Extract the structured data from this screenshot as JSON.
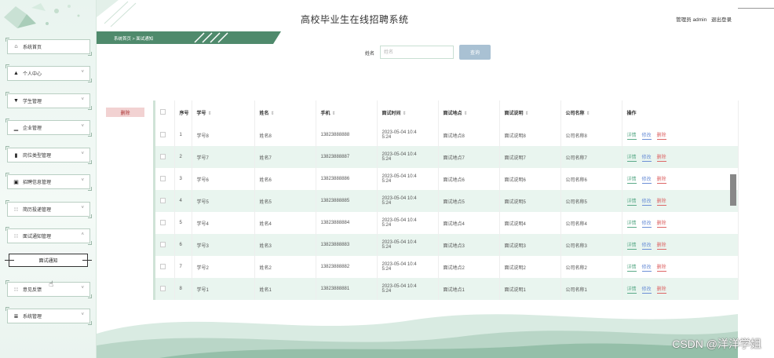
{
  "app": {
    "title": "高校毕业生在线招聘系统",
    "user_label": "管理员 admin",
    "logout_label": "退出登录"
  },
  "breadcrumb": {
    "text": "系统首页 > 面试通知"
  },
  "sidebar": {
    "items": [
      {
        "label": "系统首页",
        "icon": "home-icon",
        "glyph": "⌂"
      },
      {
        "label": "个人中心",
        "icon": "person-icon",
        "glyph": "▲"
      },
      {
        "label": "学生管理",
        "icon": "shield-icon",
        "glyph": "▼"
      },
      {
        "label": "企业管理",
        "icon": "bar-chart-icon",
        "glyph": "▁"
      },
      {
        "label": "岗位类型管理",
        "icon": "book-icon",
        "glyph": "▮"
      },
      {
        "label": "招聘信息管理",
        "icon": "grid-icon",
        "glyph": "▣"
      },
      {
        "label": "简历投递管理",
        "icon": "apps-icon",
        "glyph": "∷"
      },
      {
        "label": "面试通知管理",
        "icon": "apps-icon",
        "glyph": "∷"
      },
      {
        "label": "意见反馈",
        "icon": "apps-icon",
        "glyph": "∷"
      },
      {
        "label": "系统管理",
        "icon": "list-icon",
        "glyph": "≣"
      }
    ],
    "sub_item": "面试通知"
  },
  "search": {
    "label": "姓名",
    "placeholder": "姓名",
    "button": "查询"
  },
  "batch_delete": "删除",
  "table": {
    "headers": [
      "序号",
      "学号",
      "姓名",
      "手机",
      "面试时间",
      "面试地点",
      "面试说明",
      "公司名称",
      "操作"
    ],
    "actions": {
      "detail": "详情",
      "edit": "修改",
      "delete": "删除"
    },
    "rows": [
      {
        "no": "1",
        "sid": "学号8",
        "name": "姓名8",
        "phone": "13823888888",
        "time1": "2023-05-04 10:4",
        "time2": "5:24",
        "place": "面试地点8",
        "note": "面试说明8",
        "company": "公司名称8"
      },
      {
        "no": "2",
        "sid": "学号7",
        "name": "姓名7",
        "phone": "13823888887",
        "time1": "2023-05-04 10:4",
        "time2": "5:24",
        "place": "面试地点7",
        "note": "面试说明7",
        "company": "公司名称7"
      },
      {
        "no": "3",
        "sid": "学号6",
        "name": "姓名6",
        "phone": "13823888886",
        "time1": "2023-05-04 10:4",
        "time2": "5:24",
        "place": "面试地点6",
        "note": "面试说明6",
        "company": "公司名称6"
      },
      {
        "no": "4",
        "sid": "学号5",
        "name": "姓名5",
        "phone": "13823888885",
        "time1": "2023-05-04 10:4",
        "time2": "5:24",
        "place": "面试地点5",
        "note": "面试说明5",
        "company": "公司名称5"
      },
      {
        "no": "5",
        "sid": "学号4",
        "name": "姓名4",
        "phone": "13823888884",
        "time1": "2023-05-04 10:4",
        "time2": "5:24",
        "place": "面试地点4",
        "note": "面试说明4",
        "company": "公司名称4"
      },
      {
        "no": "6",
        "sid": "学号3",
        "name": "姓名3",
        "phone": "13823888883",
        "time1": "2023-05-04 10:4",
        "time2": "5:24",
        "place": "面试地点3",
        "note": "面试说明3",
        "company": "公司名称3"
      },
      {
        "no": "7",
        "sid": "学号2",
        "name": "姓名2",
        "phone": "13823888882",
        "time1": "2023-05-04 10:4",
        "time2": "5:24",
        "place": "面试地点2",
        "note": "面试说明2",
        "company": "公司名称2"
      },
      {
        "no": "8",
        "sid": "学号1",
        "name": "姓名1",
        "phone": "13823888881",
        "time1": "2023-05-04 10:4",
        "time2": "5:24",
        "place": "面试地点1",
        "note": "面试说明1",
        "company": "公司名称1"
      }
    ]
  },
  "watermark": "CSDN @洋洋学姐"
}
